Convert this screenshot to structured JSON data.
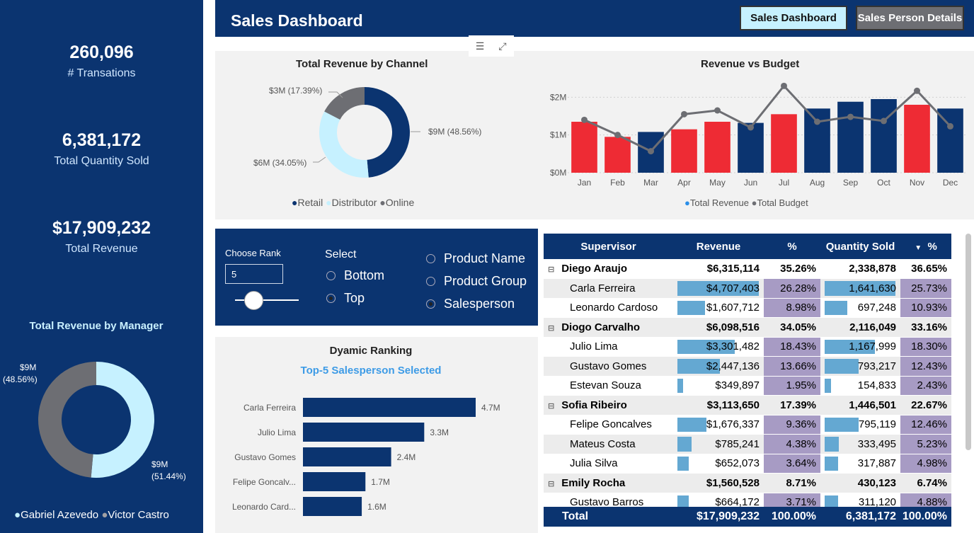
{
  "header": {
    "title": "Sales Dashboard",
    "nav": [
      "Sales Dashboard",
      "Sales Person Details"
    ]
  },
  "kpis": [
    {
      "value": "260,096",
      "label": "# Transations"
    },
    {
      "value": "6,381,172",
      "label": "Total Quantity Sold"
    },
    {
      "value": "$17,909,232",
      "label": "Total Revenue"
    }
  ],
  "manager_chart": {
    "title": "Total Revenue by Manager",
    "slices": [
      {
        "name": "Gabriel Azevedo",
        "value": 51.44,
        "color": "#c6f1ff",
        "label_value": "$9M",
        "label_pct": "(51.44%)"
      },
      {
        "name": "Victor Castro",
        "value": 48.56,
        "color": "#6d6e73",
        "label_value": "$9M",
        "label_pct": "(48.56%)"
      }
    ]
  },
  "channel_chart": {
    "title": "Total Revenue by Channel",
    "slices": [
      {
        "name": "Retail",
        "value": 48.56,
        "color": "#0b3470",
        "label": "$9M (48.56%)"
      },
      {
        "name": "Distributor",
        "value": 34.05,
        "color": "#c6f1ff",
        "label": "$6M (34.05%)"
      },
      {
        "name": "Online",
        "value": 17.39,
        "color": "#6d6e73",
        "label": "$3M (17.39%)"
      }
    ]
  },
  "chart_data": [
    {
      "type": "bar",
      "title": "Revenue vs Budget",
      "categories": [
        "Jan",
        "Feb",
        "Mar",
        "Apr",
        "May",
        "Jun",
        "Jul",
        "Aug",
        "Sep",
        "Oct",
        "Nov",
        "Dec"
      ],
      "yticks": [
        "$0M",
        "$1M",
        "$2M"
      ],
      "ylim": [
        0,
        2.4
      ],
      "series": [
        {
          "name": "Total Revenue",
          "values": [
            1.35,
            0.95,
            1.08,
            1.15,
            1.35,
            1.32,
            1.55,
            1.7,
            1.88,
            1.95,
            1.8,
            1.7
          ],
          "colors": [
            "red",
            "red",
            "navy",
            "red",
            "red",
            "navy",
            "red",
            "navy",
            "navy",
            "navy",
            "red",
            "navy"
          ]
        },
        {
          "name": "Total Budget",
          "values": [
            1.4,
            1.0,
            0.57,
            1.55,
            1.65,
            1.2,
            2.3,
            1.35,
            1.48,
            1.37,
            2.17,
            1.23
          ]
        }
      ],
      "legend": "bottom",
      "colors": {
        "red": "#ee2b34",
        "navy": "#0b3470",
        "line": "#6d6e73",
        "revenue_legend": "#2a8ee8"
      }
    },
    {
      "type": "bar",
      "title": "Dyamic Ranking",
      "subtitle": "Top-5 Salesperson Selected",
      "categories": [
        "Carla Ferreira",
        "Julio Lima",
        "Gustavo Gomes",
        "Felipe Goncalv...",
        "Leonardo Card..."
      ],
      "values": [
        4.7,
        3.3,
        2.4,
        1.7,
        1.6
      ],
      "value_labels": [
        "4.7M",
        "3.3M",
        "2.4M",
        "1.7M",
        "1.6M"
      ],
      "orientation": "horizontal"
    }
  ],
  "rank_panel": {
    "choose_label": "Choose Rank",
    "input_value": "5",
    "select_label": "Select",
    "options_order": [
      {
        "label": "Bottom",
        "on": false
      },
      {
        "label": "Top",
        "on": true
      }
    ],
    "options_dim": [
      {
        "label": "Product Name",
        "on": false
      },
      {
        "label": "Product Group",
        "on": false
      },
      {
        "label": "Salesperson",
        "on": true
      }
    ]
  },
  "table": {
    "headers": [
      "Supervisor",
      "Revenue",
      "%",
      "Quantity Sold",
      "%"
    ],
    "rows": [
      {
        "group": true,
        "name": "Diego Araujo",
        "rev": "$6,315,114",
        "p1": "35.26%",
        "qty": "2,338,878",
        "p2": "36.65%"
      },
      {
        "group": false,
        "name": "Carla Ferreira",
        "rev": "$4,707,403",
        "p1": "26.28%",
        "qty": "1,641,630",
        "p2": "25.73%",
        "rb": 100,
        "qb": 100
      },
      {
        "group": false,
        "name": "Leonardo Cardoso",
        "rev": "$1,607,712",
        "p1": "8.98%",
        "qty": "697,248",
        "p2": "10.93%",
        "rb": 34,
        "qb": 32
      },
      {
        "group": true,
        "name": "Diogo Carvalho",
        "rev": "$6,098,516",
        "p1": "34.05%",
        "qty": "2,116,049",
        "p2": "33.16%"
      },
      {
        "group": false,
        "name": "Julio Lima",
        "rev": "$3,301,482",
        "p1": "18.43%",
        "qty": "1,167,999",
        "p2": "18.30%",
        "rb": 70,
        "qb": 71
      },
      {
        "group": false,
        "name": "Gustavo Gomes",
        "rev": "$2,447,136",
        "p1": "13.66%",
        "qty": "793,217",
        "p2": "12.43%",
        "rb": 52,
        "qb": 48
      },
      {
        "group": false,
        "name": "Estevan Souza",
        "rev": "$349,897",
        "p1": "1.95%",
        "qty": "154,833",
        "p2": "2.43%",
        "rb": 7,
        "qb": 9
      },
      {
        "group": true,
        "name": "Sofia Ribeiro",
        "rev": "$3,113,650",
        "p1": "17.39%",
        "qty": "1,446,501",
        "p2": "22.67%"
      },
      {
        "group": false,
        "name": "Felipe Goncalves",
        "rev": "$1,676,337",
        "p1": "9.36%",
        "qty": "795,119",
        "p2": "12.46%",
        "rb": 36,
        "qb": 48
      },
      {
        "group": false,
        "name": "Mateus Costa",
        "rev": "$785,241",
        "p1": "4.38%",
        "qty": "333,495",
        "p2": "5.23%",
        "rb": 17,
        "qb": 20
      },
      {
        "group": false,
        "name": "Julia Silva",
        "rev": "$652,073",
        "p1": "3.64%",
        "qty": "317,887",
        "p2": "4.98%",
        "rb": 14,
        "qb": 19
      },
      {
        "group": true,
        "name": "Emily Rocha",
        "rev": "$1,560,528",
        "p1": "8.71%",
        "qty": "430,123",
        "p2": "6.74%"
      },
      {
        "group": false,
        "name": "Gustavo Barros",
        "rev": "$664,172",
        "p1": "3.71%",
        "qty": "311,120",
        "p2": "4.88%",
        "rb": 14,
        "qb": 19
      }
    ],
    "totals": {
      "name": "Total",
      "rev": "$17,909,232",
      "p1": "100.00%",
      "qty": "6,381,172",
      "p2": "100.00%"
    }
  }
}
